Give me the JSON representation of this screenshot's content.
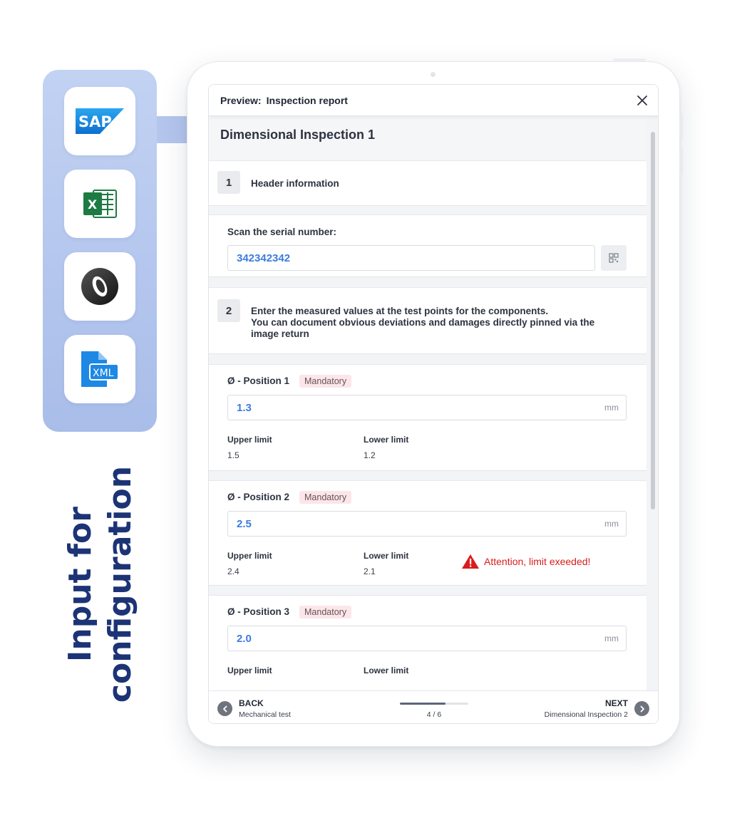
{
  "integrations": {
    "heading_line1": "Input for",
    "heading_line2": "configuration",
    "items": [
      {
        "name": "sap-logo",
        "text": "SAP"
      },
      {
        "name": "excel-icon",
        "text": "X"
      },
      {
        "name": "json-icon",
        "text": ""
      },
      {
        "name": "xml-file-icon",
        "text": "XML"
      }
    ],
    "accent_color": "#1c3476"
  },
  "preview": {
    "label": "Preview:",
    "title": "Inspection report"
  },
  "section_title": "Dimensional Inspection 1",
  "steps": [
    {
      "number": "1",
      "text": "Header information"
    },
    {
      "number": "2",
      "text_lines": [
        "Enter the measured values at the test points for the components.",
        "You can document obvious deviations and damages directly pinned via the",
        "image return"
      ]
    }
  ],
  "serial": {
    "label": "Scan the serial number:",
    "value": "342342342"
  },
  "labels": {
    "mandatory": "Mandatory",
    "upper_limit": "Upper limit",
    "lower_limit": "Lower limit",
    "unit": "mm"
  },
  "positions": [
    {
      "label": "Ø  - Position 1",
      "value": "1.3",
      "upper": "1.5",
      "lower": "1.2"
    },
    {
      "label": "Ø  - Position 2",
      "value": "2.5",
      "upper": "2.4",
      "lower": "2.1",
      "alert": "Attention, limit exeeded!"
    },
    {
      "label": "Ø  - Position 3",
      "value": "2.0"
    }
  ],
  "nav": {
    "back_label": "BACK",
    "back_sub": "Mechanical test",
    "next_label": "NEXT",
    "next_sub": "Dimensional Inspection 2",
    "progress_text": "4 / 6",
    "progress_current": 4,
    "progress_total": 6
  },
  "colors": {
    "input_value": "#3d7be0",
    "alert": "#d91c1c",
    "badge_bg": "#fbe6ea"
  }
}
